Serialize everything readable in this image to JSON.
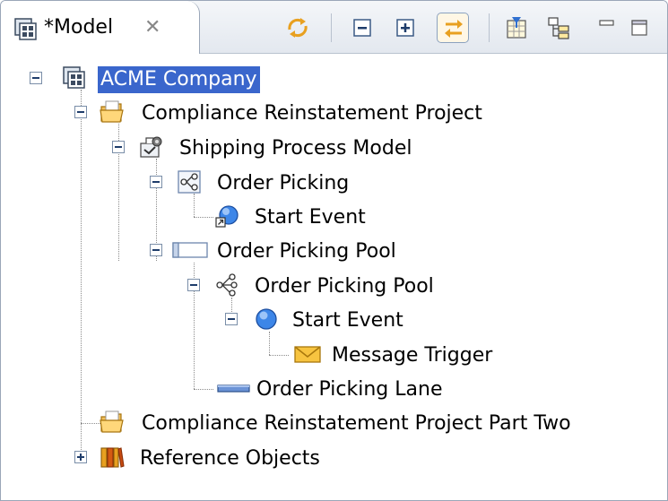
{
  "tab": {
    "label": "*Model",
    "close_glyph": "✕",
    "icon": "model-icon"
  },
  "toolbar": [
    {
      "name": "sync-icon"
    },
    {
      "name": "collapse-all-icon"
    },
    {
      "name": "expand-all-icon"
    },
    {
      "name": "link-with-editor-icon",
      "active": true
    },
    {
      "name": "filter-icon"
    },
    {
      "name": "hierarchy-icon"
    },
    {
      "name": "minimize-icon"
    },
    {
      "name": "maximize-icon"
    }
  ],
  "tree": [
    {
      "label": "ACME Company",
      "icon": "company-icon",
      "toggle": "minus",
      "selected": true
    },
    {
      "label": "Compliance Reinstatement Project",
      "icon": "project-folder-icon",
      "toggle": "minus"
    },
    {
      "label": "Shipping Process Model",
      "icon": "process-model-icon",
      "toggle": "minus"
    },
    {
      "label": "Order Picking",
      "icon": "process-icon",
      "toggle": "minus"
    },
    {
      "label": "Start Event",
      "icon": "start-event-link-icon",
      "toggle": "none"
    },
    {
      "label": "Order Picking Pool",
      "icon": "pool-icon",
      "toggle": "minus"
    },
    {
      "label": "Order Picking Pool",
      "icon": "process-icon",
      "toggle": "minus"
    },
    {
      "label": "Start Event",
      "icon": "start-event-icon",
      "toggle": "minus"
    },
    {
      "label": "Message Trigger",
      "icon": "message-trigger-icon",
      "toggle": "none"
    },
    {
      "label": "Order Picking Lane",
      "icon": "lane-icon",
      "toggle": "none"
    },
    {
      "label": "Compliance Reinstatement Project Part Two",
      "icon": "project-folder-icon",
      "toggle": "none"
    },
    {
      "label": "Reference Objects",
      "icon": "reference-library-icon",
      "toggle": "plus"
    }
  ]
}
